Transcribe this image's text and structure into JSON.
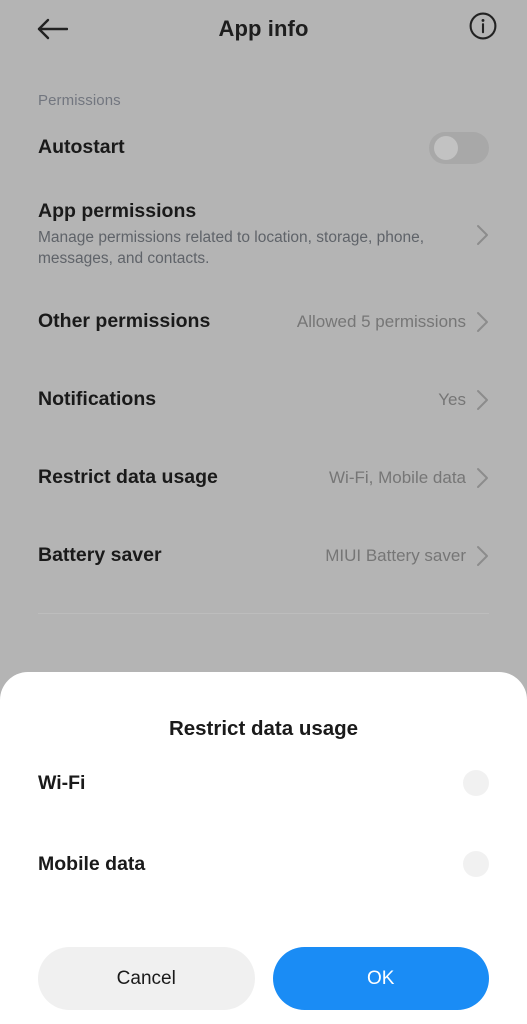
{
  "appbar": {
    "title": "App info",
    "back_icon": "arrow-left-icon",
    "info_icon": "info-circle-icon"
  },
  "section": {
    "label": "Permissions"
  },
  "rows": [
    {
      "title": "Autostart",
      "subtitle": "",
      "value": "",
      "control": "toggle",
      "toggle_on": false
    },
    {
      "title": "App permissions",
      "subtitle": "Manage permissions related to location, storage, phone, messages, and contacts.",
      "value": "",
      "control": "chevron"
    },
    {
      "title": "Other permissions",
      "subtitle": "",
      "value": "Allowed 5 permissions",
      "control": "chevron"
    },
    {
      "title": "Notifications",
      "subtitle": "",
      "value": "Yes",
      "control": "chevron"
    },
    {
      "title": "Restrict data usage",
      "subtitle": "",
      "value": "Wi-Fi, Mobile data",
      "control": "chevron"
    },
    {
      "title": "Battery saver",
      "subtitle": "",
      "value": "MIUI Battery saver",
      "control": "chevron"
    }
  ],
  "dialog": {
    "title": "Restrict data usage",
    "options": [
      {
        "label": "Wi-Fi",
        "checked": false
      },
      {
        "label": "Mobile data",
        "checked": false
      }
    ],
    "cancel_label": "Cancel",
    "ok_label": "OK"
  },
  "colors": {
    "accent": "#1a8cf5",
    "scrim_background": "#b4b4b4",
    "sheet_background": "#ffffff",
    "text_primary": "#1a1a1a",
    "text_secondary": "#767676",
    "section_label": "#72767f",
    "button_secondary": "#f0f0f0"
  }
}
